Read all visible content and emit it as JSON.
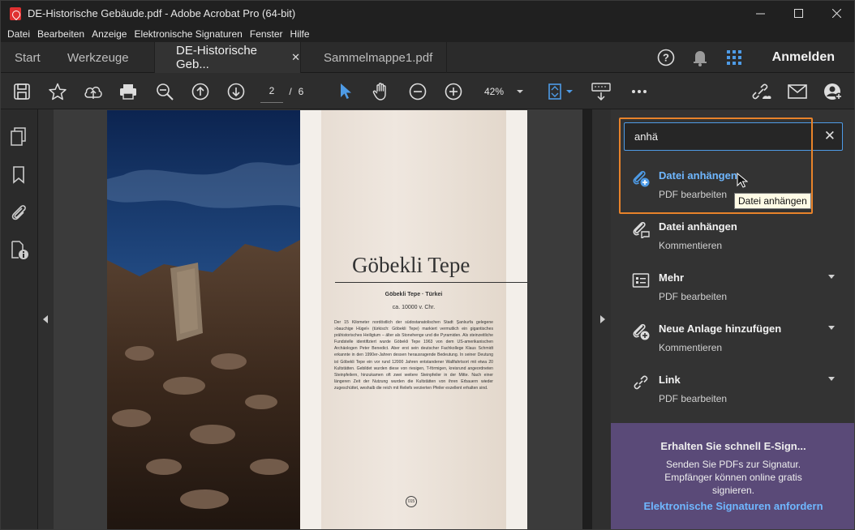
{
  "window": {
    "title": "DE-Historische Gebäude.pdf - Adobe Acrobat Pro (64-bit)",
    "controls": [
      "minimize",
      "maximize",
      "close"
    ]
  },
  "menu": [
    "Datei",
    "Bearbeiten",
    "Anzeige",
    "Elektronische Signaturen",
    "Fenster",
    "Hilfe"
  ],
  "tabs": {
    "start": "Start",
    "tools": "Werkzeuge",
    "doc1": "DE-Historische Geb...",
    "doc2": "Sammelmappe1.pdf",
    "close": "✕"
  },
  "header": {
    "sign_in": "Anmelden",
    "icons": [
      "help-icon",
      "bell-icon",
      "apps-grid-icon"
    ]
  },
  "toolbar": {
    "page_current": "2",
    "page_separator": "/",
    "page_total": "6",
    "zoom": "42%"
  },
  "document": {
    "title": "Göbekli Tepe",
    "subtitle": "Göbekli Tepe · Türkei",
    "date": "ca. 10000 v. Chr.",
    "body": "Der 15 Kilometer nordöstlich der südostanatolischen Stadt Şanlıurfa gelegene »bauchige Hügel« (türkisch: Göbekli Tepe) markiert vermutlich ein gigantisches prähistorisches Heiligtum – älter als Stonehenge und die Pyramiden. Als steinzeitliche Fundstelle identifiziert wurde Göbekli Tepe 1963 von dem US-amerikanischen Archäologen Peter Benedict. Aber erst sein deutscher Fachkollege Klaus Schmidt erkannte in den 1990er-Jahren dessen herausragende Bedeutung. In seiner Deutung ist Göbekli Tepe ein vor rund 12000 Jahren entstandener Wallfahrtsort mit etwa 20 Kultstätten. Gebildet wurden diese von riesigen, T-förmigen, kreisrund angeordneten Steinpfeilern, hinzukamen oft zwei weitere Steinpfeiler in der Mitte. Nach einer längeren Zeit der Nutzung wurden die Kultstätten von ihren Erbauern wieder zugeschüttet, weshalb die reich mit Reliefs verzierten Pfeiler exzellent erhalten sind.",
    "page_number": "015"
  },
  "search": {
    "value": "anhä",
    "clear": "✕"
  },
  "results": [
    {
      "name": "Datei anhängen",
      "category": "PDF bearbeiten",
      "icon": "attach-file-icon",
      "highlighted": true
    },
    {
      "name": "Datei anhängen",
      "category": "Kommentieren",
      "icon": "attach-comment-icon"
    },
    {
      "name": "Mehr",
      "category": "PDF bearbeiten",
      "icon": "more-list-icon",
      "expandable": true
    },
    {
      "name": "Neue Anlage hinzufügen",
      "category": "Kommentieren",
      "icon": "add-attachment-icon",
      "expandable": true
    },
    {
      "name": "Link",
      "category": "PDF bearbeiten",
      "icon": "link-icon",
      "expandable": true
    }
  ],
  "tooltip": "Datei anhängen",
  "promo": {
    "title": "Erhalten Sie schnell E-Sign...",
    "body": "Senden Sie PDFs zur Signatur. Empfänger können online gratis signieren.",
    "link": "Elektronische Signaturen anfordern"
  },
  "colors": {
    "accent": "#4e9be6",
    "highlight_border": "#e8832a",
    "promo_bg": "#5a4a78",
    "link": "#6fb7ff"
  }
}
